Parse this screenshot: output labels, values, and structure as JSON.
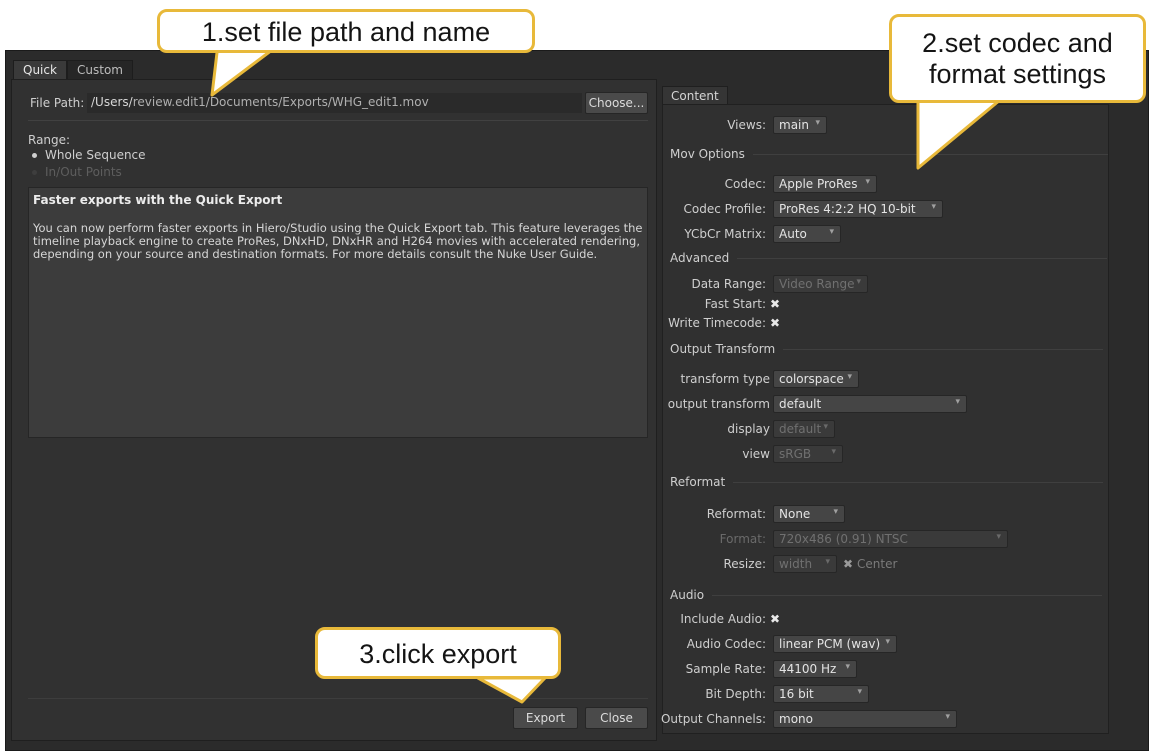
{
  "tabs": [
    "Quick",
    "Custom"
  ],
  "file_path": {
    "label": "File Path:",
    "value_prefix": "/Users/",
    "value_rest": "review.edit1/Documents/Exports/WHG_edit1.mov",
    "choose_button": "Choose..."
  },
  "range": {
    "label": "Range:",
    "options": [
      "Whole Sequence",
      "In/Out Points"
    ],
    "selected": "Whole Sequence"
  },
  "info": {
    "title": "Faster exports with the Quick Export",
    "body": "You can now perform faster exports in Hiero/Studio using the Quick Export tab. This feature leverages the timeline playback engine to create ProRes, DNxHD, DNxHR and H264 movies with accelerated rendering, depending on your source and destination formats. For more details consult the Nuke User Guide."
  },
  "buttons": {
    "export": "Export",
    "close": "Close"
  },
  "content": {
    "tab": "Content",
    "views_label": "Views:",
    "views_value": "main",
    "mov_options": "Mov Options",
    "codec_label": "Codec:",
    "codec_value": "Apple ProRes",
    "codec_profile_label": "Codec Profile:",
    "codec_profile_value": "ProRes 4:2:2 HQ 10-bit",
    "ycbcr_label": "YCbCr Matrix:",
    "ycbcr_value": "Auto",
    "advanced": "Advanced",
    "data_range_label": "Data Range:",
    "data_range_value": "Video Range",
    "fast_start_label": "Fast Start:",
    "write_timecode_label": "Write Timecode:",
    "output_transform": "Output Transform",
    "transform_type_label": "transform type",
    "transform_type_value": "colorspace",
    "output_transform_label": "output transform",
    "output_transform_value": "default",
    "display_label": "display",
    "display_value": "default",
    "view_label": "view",
    "view_value": "sRGB",
    "reformat": "Reformat",
    "reformat_label": "Reformat:",
    "reformat_value": "None",
    "format_label": "Format:",
    "format_value": "720x486 (0.91) NTSC",
    "resize_label": "Resize:",
    "resize_value": "width",
    "center_label": "Center",
    "audio": "Audio",
    "include_audio_label": "Include Audio:",
    "audio_codec_label": "Audio Codec:",
    "audio_codec_value": "linear PCM (wav)",
    "sample_rate_label": "Sample Rate:",
    "sample_rate_value": "44100 Hz",
    "bit_depth_label": "Bit Depth:",
    "bit_depth_value": "16 bit",
    "output_channels_label": "Output Channels:",
    "output_channels_value": "mono",
    "check_mark": "✖"
  },
  "callouts": {
    "c1": "1.set file path and name",
    "c2_line1": "2.set codec and",
    "c2_line2": "format settings",
    "c3": "3.click export"
  },
  "colors": {
    "callout_border": "#e8b93a",
    "panel_bg": "#2b2b2b",
    "accent_radio": "#c9c9c9"
  }
}
